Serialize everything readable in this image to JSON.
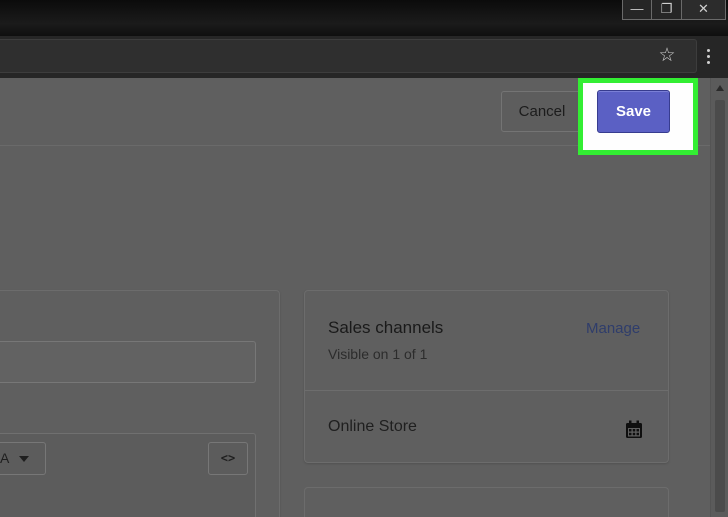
{
  "window": {
    "minimize_glyph": "—",
    "restore_glyph": "❐",
    "close_glyph": "✕"
  },
  "toolbar": {
    "bookmark_icon": "star-icon",
    "menu_icon": "kebab-menu-icon"
  },
  "header": {
    "cancel_label": "Cancel",
    "save_label": "Save",
    "highlight_color": "#33ee33",
    "save_color": "#5b60c4"
  },
  "editor": {
    "format_value": "A",
    "code_label": "<>"
  },
  "sales_channels": {
    "title": "Sales channels",
    "subtitle": "Visible on 1 of 1",
    "manage_label": "Manage",
    "channels": [
      {
        "name": "Online Store",
        "icon": "calendar-icon"
      }
    ]
  }
}
